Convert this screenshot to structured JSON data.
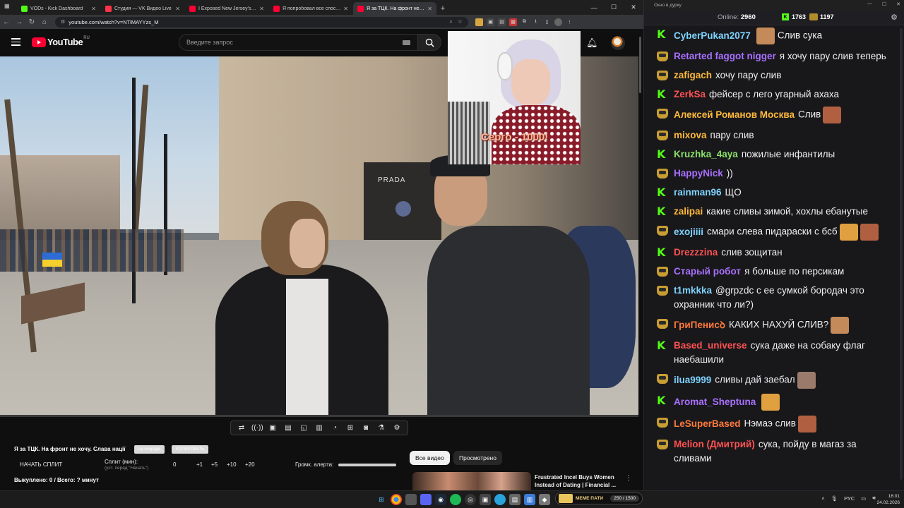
{
  "browser": {
    "tabs": [
      {
        "title": "VODs - Kick Dashboard",
        "favicon_color": "#53fc18",
        "active": false
      },
      {
        "title": "Студия — VK Видео Live",
        "favicon_color": "#ff3347",
        "active": false
      },
      {
        "title": "I Exposed New Jersey's Jewish",
        "favicon_color": "#ff0033",
        "active": false
      },
      {
        "title": "Я попробовал все способы б",
        "favicon_color": "#ff0033",
        "active": false
      },
      {
        "title": "Я за ТЦК. На фронт не хочу. С",
        "favicon_color": "#ff0033",
        "active": true
      }
    ],
    "url": "youtube.com/watch?v=NTlMAYYzs_M"
  },
  "youtube": {
    "logo_text": "YouTube",
    "logo_region": "RU",
    "search_placeholder": "Введите запрос",
    "donation_overlay": "Серго - 1000!",
    "shop_sign": "PRADA",
    "video_title": "Я за ТЦК. На фронт не хочу. Слава нації",
    "tag_buttons": [
      "на очереди",
      "КОПИРОВАТЬ"
    ],
    "split": {
      "start_label": "НАЧАТЬ СПЛИТ",
      "minutes_label": "Сплит (мин):",
      "minutes_hint": "(уст. перед \"Начать\")",
      "minutes_value": "0",
      "increments": [
        "+1",
        "+5",
        "+10",
        "+20"
      ],
      "alert_volume_label": "Громк. алерта:",
      "alert_volume": 1.0,
      "bought_text": "Выкуплено: 0 / Всего: ? минут"
    },
    "chips": [
      "Все видео",
      "Просмотрено"
    ],
    "recommended": {
      "title": "Frustrated Incel Buys Women Instead of Dating | Financial ..."
    }
  },
  "chat": {
    "window_title": "Окно в дурку",
    "online_label": "Online:",
    "online_count": "2960",
    "kick_count": "1763",
    "twitch_count": "1197",
    "messages": [
      {
        "platform": "kick",
        "nick": "CyberPukan2077",
        "color": "#7fd3ff",
        "text": "Слив сука",
        "emote_before": true
      },
      {
        "platform": "twitch",
        "nick": "Retarted faggot nigger",
        "color": "#a970ff",
        "text": "я хочу пару слив теперь"
      },
      {
        "platform": "twitch",
        "nick": "zafigach",
        "color": "#ffb93a",
        "text": "хочу пару слив"
      },
      {
        "platform": "kick",
        "nick": "ZerkSa",
        "color": "#ff5252",
        "text": "фейсер с лего угарный ахаха"
      },
      {
        "platform": "twitch",
        "nick": "Алексей Романов Москва",
        "color": "#ffb93a",
        "text": "Слив",
        "emote_after": true
      },
      {
        "platform": "twitch",
        "nick": "mixova",
        "color": "#ffb93a",
        "text": "пару слив"
      },
      {
        "platform": "kick",
        "nick": "Kruzhka_4aya",
        "color": "#8be06a",
        "text": "пожилые инфантилы"
      },
      {
        "platform": "twitch",
        "nick": "HappyNick",
        "color": "#a970ff",
        "text": "))"
      },
      {
        "platform": "kick",
        "nick": "rainman96",
        "color": "#7fd3ff",
        "text": "ЩО"
      },
      {
        "platform": "kick",
        "nick": "zalipai",
        "color": "#ffb93a",
        "text": "какие сливы зимой, хохлы ебанутые"
      },
      {
        "platform": "twitch",
        "nick": "exojiiii",
        "color": "#7fd3ff",
        "text": "смари слева пидараски с бсб",
        "emote_after": true,
        "emote_count": 2
      },
      {
        "platform": "kick",
        "nick": "Drezzzina",
        "color": "#ff5252",
        "text": "слив зощитан"
      },
      {
        "platform": "twitch",
        "nick": "Старый робот",
        "color": "#a970ff",
        "text": "я больше по персикам"
      },
      {
        "platform": "twitch",
        "nick": "t1mkkka",
        "color": "#7fd3ff",
        "text": "@grpzdc с ее сумкой бородач это охранник что ли?)"
      },
      {
        "platform": "twitch",
        "nick": "ГриПенисꝺ",
        "color": "#ff7a3a",
        "text": "КАКИХ НАХУЙ СЛИВ?",
        "emote_after": true
      },
      {
        "platform": "kick",
        "nick": "Based_universe",
        "color": "#ff5252",
        "text": "сука даже на собаку флаг наебашили"
      },
      {
        "platform": "twitch",
        "nick": "ilua9999",
        "color": "#7fd3ff",
        "text": "сливы дай заебал",
        "emote_after": true
      },
      {
        "platform": "kick",
        "nick": "Aromat_Sheptuna",
        "color": "#a970ff",
        "text": "",
        "emote_after": true
      },
      {
        "platform": "twitch",
        "nick": "LeSuperBased",
        "color": "#ff7a3a",
        "text": "Нэмаэ слив",
        "emote_after": true
      },
      {
        "platform": "twitch",
        "nick": "Melion (Дмитрий)",
        "color": "#ff5252",
        "text": "сука, пойду в магаз за сливами"
      }
    ]
  },
  "taskbar": {
    "donate_label": "МЕМЕ ПАТИ",
    "donate_count": "250 / 1500",
    "lang": "РУС",
    "time": "16:01",
    "date": "24.02.2026"
  }
}
